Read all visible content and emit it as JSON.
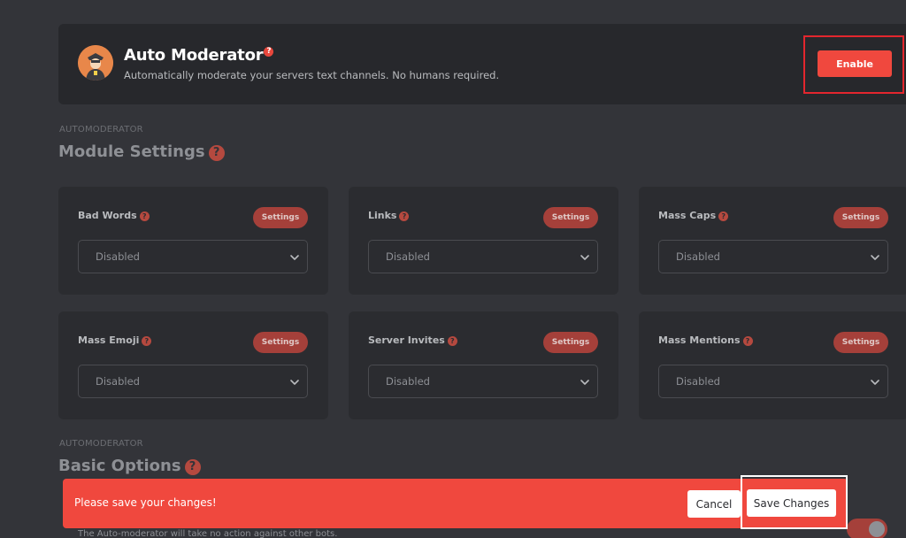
{
  "header": {
    "title": "Auto Moderator",
    "subtitle": "Automatically moderate your servers text channels. No humans required.",
    "enable_label": "Enable",
    "help_glyph": "?"
  },
  "module_section": {
    "eyebrow": "AUTOMODERATOR",
    "title": "Module Settings"
  },
  "modules": [
    {
      "name": "Bad Words",
      "settings_label": "Settings",
      "value": "Disabled"
    },
    {
      "name": "Links",
      "settings_label": "Settings",
      "value": "Disabled"
    },
    {
      "name": "Mass Caps",
      "settings_label": "Settings",
      "value": "Disabled"
    },
    {
      "name": "Mass Emoji",
      "settings_label": "Settings",
      "value": "Disabled"
    },
    {
      "name": "Server Invites",
      "settings_label": "Settings",
      "value": "Disabled"
    },
    {
      "name": "Mass Mentions",
      "settings_label": "Settings",
      "value": "Disabled"
    }
  ],
  "basic_section": {
    "eyebrow": "AUTOMODERATOR",
    "title": "Basic Options",
    "partial_text": "The Auto-moderator will take no action against other bots.",
    "toggle_on": true
  },
  "toast": {
    "message": "Please save your changes!",
    "cancel_label": "Cancel",
    "save_label": "Save Changes"
  },
  "colors": {
    "accent": "#f0483e",
    "background": "#333439",
    "card": "#2b2c30"
  },
  "icons": {
    "avatar": "police-officer-icon",
    "help": "question-circle-icon",
    "select": "chevron-down-icon"
  }
}
